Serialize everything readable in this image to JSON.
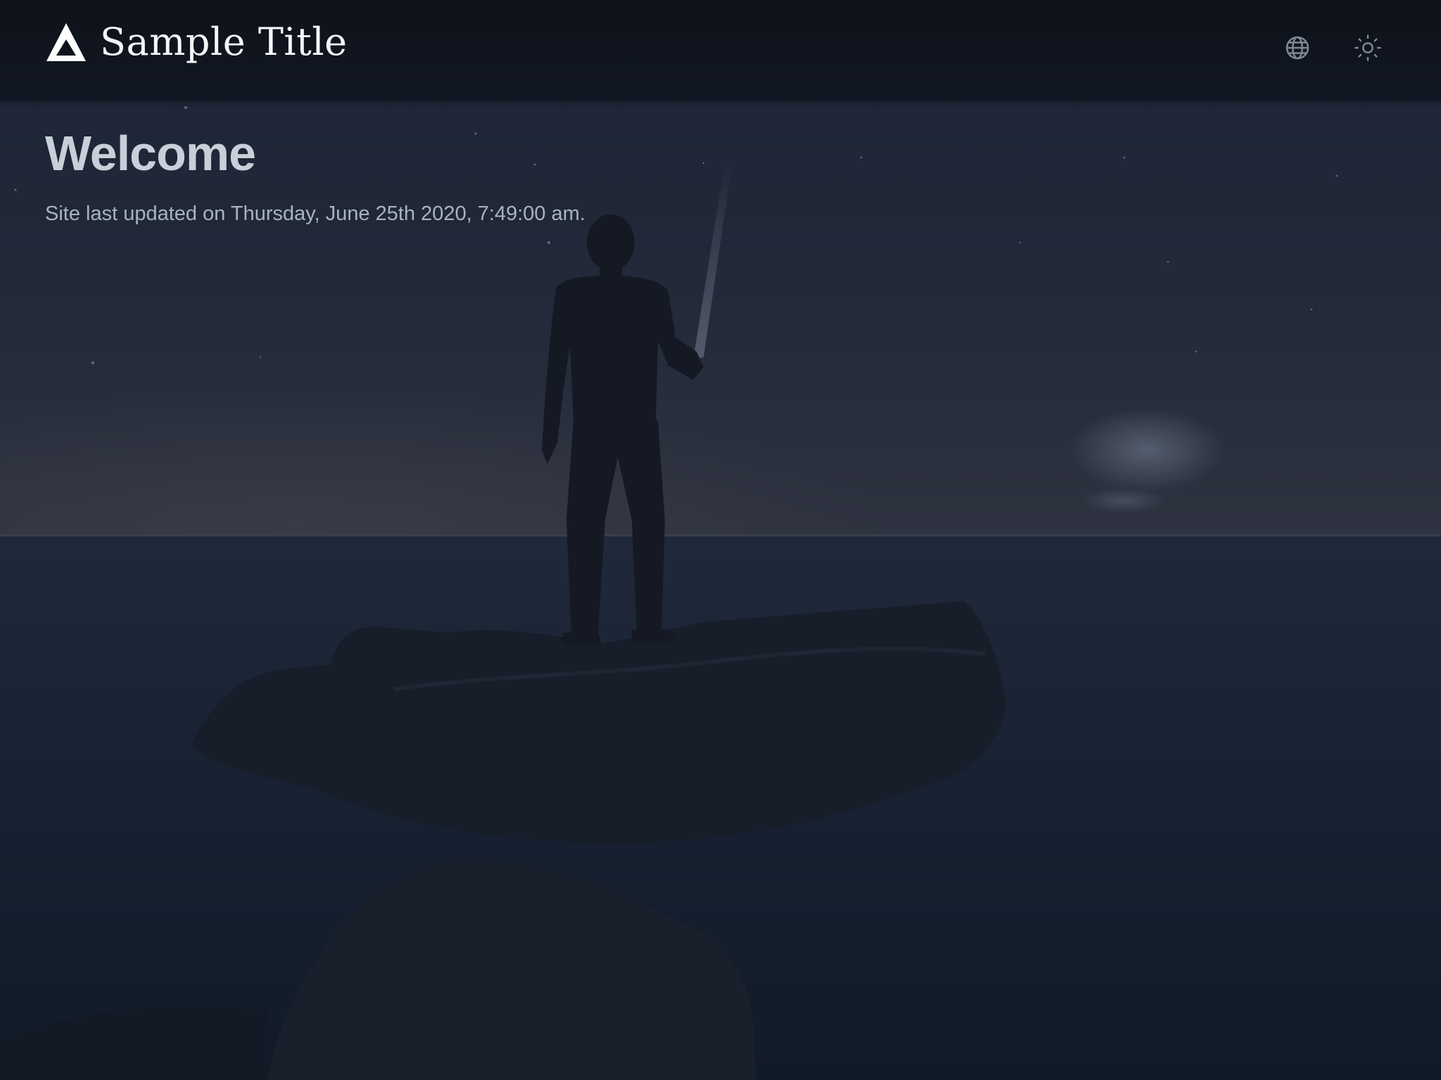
{
  "header": {
    "title": "Sample Title",
    "actions": {
      "language_icon": "globe-icon",
      "theme_icon": "sun-icon"
    }
  },
  "main": {
    "heading": "Welcome",
    "last_updated": "Site last updated on Thursday, June 25th 2020, 7:49:00 am."
  },
  "theme": {
    "header_bg": "#0f141d",
    "page_bg": "#1b2434",
    "heading_color": "#c7cfd8",
    "text_color": "#a9b3c0",
    "icon_color": "#7f8896"
  }
}
